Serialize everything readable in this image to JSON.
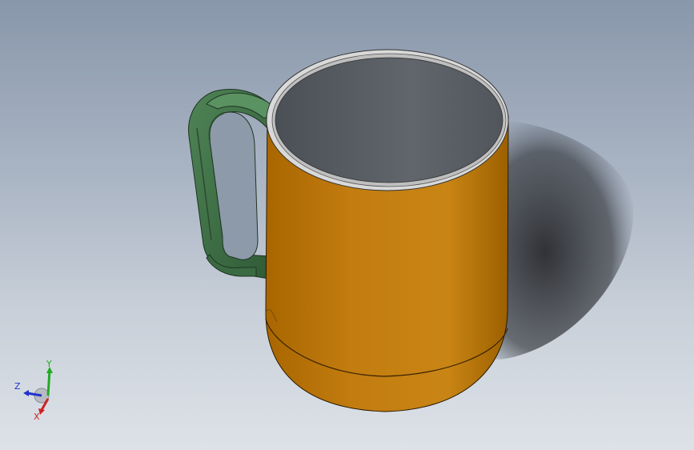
{
  "viewport": {
    "background_top": "#8997ab",
    "background_bottom": "#dde2e8"
  },
  "model": {
    "body_color": "#c57f10",
    "handle_color": "#3f6e46",
    "inner_color": "#5c6268",
    "rim_color": "#d8d8d8"
  },
  "triad": {
    "x_label": "X",
    "y_label": "Y",
    "z_label": "Z",
    "x_color": "#cc2222",
    "y_color": "#22aa22",
    "z_color": "#2233cc"
  }
}
